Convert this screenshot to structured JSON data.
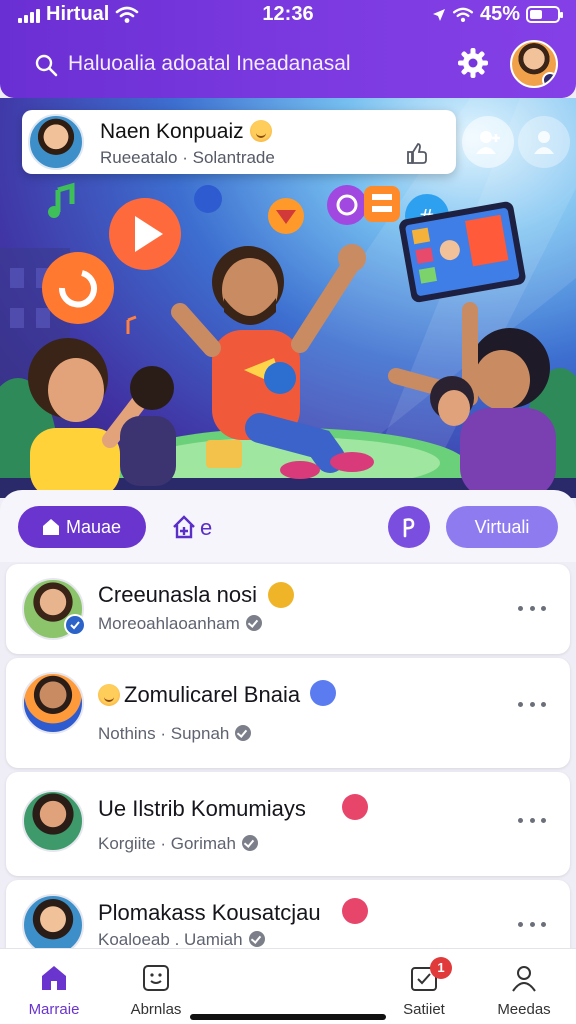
{
  "status_bar": {
    "carrier": "Hirtual",
    "time": "12:36",
    "battery_percent": "45%",
    "battery_level": 0.45
  },
  "search": {
    "placeholder": "Haluoalia adoatal Ineadanasal"
  },
  "featured": {
    "name": "Naen Konpuaiz",
    "subtitle": "Rueeatalo · Solantrade"
  },
  "filters": {
    "home_label": "Mauae",
    "explore_label": "e",
    "virtual_label": "Virtuali"
  },
  "list": [
    {
      "title": "Creeunasla nosi",
      "subtitle": "Moreoahlaoanham",
      "badge_color": "#f0b429"
    },
    {
      "title": "Zomulicarel Bnaia",
      "subtitle": "Nothins · Supnah",
      "badge_color": "#5b7cf0"
    },
    {
      "title": "Ue Ilstrib Komumiays",
      "subtitle": "Korgiite · Gorimah",
      "badge_color": "#e8456b"
    },
    {
      "title": "Plomakass Kousatcjau",
      "subtitle": "Koaloeab . Uamiah",
      "badge_color": "#e8456b"
    }
  ],
  "nav": {
    "items": [
      {
        "label": "Marraie",
        "icon": "home-icon"
      },
      {
        "label": "Abrnlas",
        "icon": "smile-box-icon"
      },
      {
        "label": "Satiiet",
        "icon": "checkbox-icon",
        "badge": "1"
      },
      {
        "label": "Meedas",
        "icon": "person-icon"
      }
    ]
  },
  "colors": {
    "header": "#6a2fd3",
    "accent": "#6a35cf",
    "chip_virtual": "#8e7bf0",
    "notification": "#e03a3a"
  }
}
